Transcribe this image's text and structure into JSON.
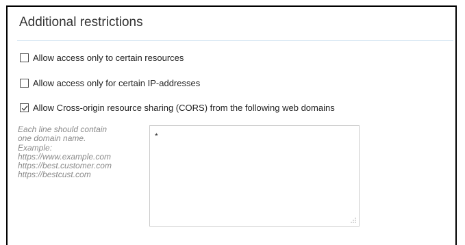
{
  "section": {
    "title": "Additional restrictions"
  },
  "options": [
    {
      "label": "Allow access only to certain resources",
      "checked": false
    },
    {
      "label": "Allow access only for certain IP-addresses",
      "checked": false
    },
    {
      "label": "Allow Cross-origin resource sharing (CORS) from the following web domains",
      "checked": true
    }
  ],
  "cors": {
    "hint_lines": [
      "Each line should contain",
      "one domain name.",
      "Example:",
      "https://www.example.com",
      "https://best.customer.com",
      "https://bestcust.com"
    ],
    "domains_value": "*"
  },
  "icons": {
    "checkmark": "checkmark-icon",
    "resize": "resize-grip-icon"
  },
  "colors": {
    "title_rule": "#cfe2f0",
    "hint_text": "#8a8a8a",
    "checkbox_border": "#4a4a4a"
  }
}
